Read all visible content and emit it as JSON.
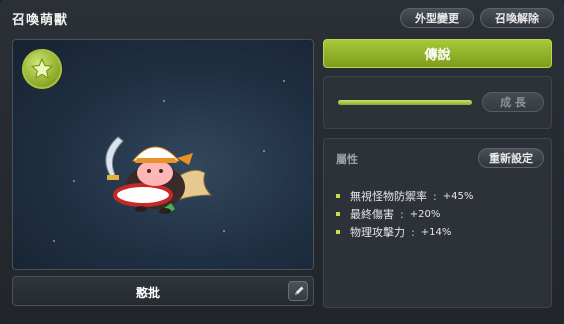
{
  "window": {
    "title": "召喚萌獸"
  },
  "header": {
    "appearance_label": "外型變更",
    "dismiss_label": "召喚解除"
  },
  "pet": {
    "name": "憨批"
  },
  "grade": {
    "label": "傳說"
  },
  "growth": {
    "button_label": "成 長",
    "progress": 1.0
  },
  "stats": {
    "title": "屬性",
    "reset_label": "重新設定",
    "separator": ":",
    "items": [
      {
        "name": "無視怪物防禦率",
        "value": "+45%"
      },
      {
        "name": "最終傷害",
        "value": "+20%"
      },
      {
        "name": "物理攻擊力",
        "value": "+14%"
      }
    ]
  },
  "colors": {
    "accent": "#98bd2e",
    "panel": "#2c3238",
    "bullet": "#c8e04a"
  },
  "icons": [
    "star-icon",
    "pencil-icon"
  ]
}
